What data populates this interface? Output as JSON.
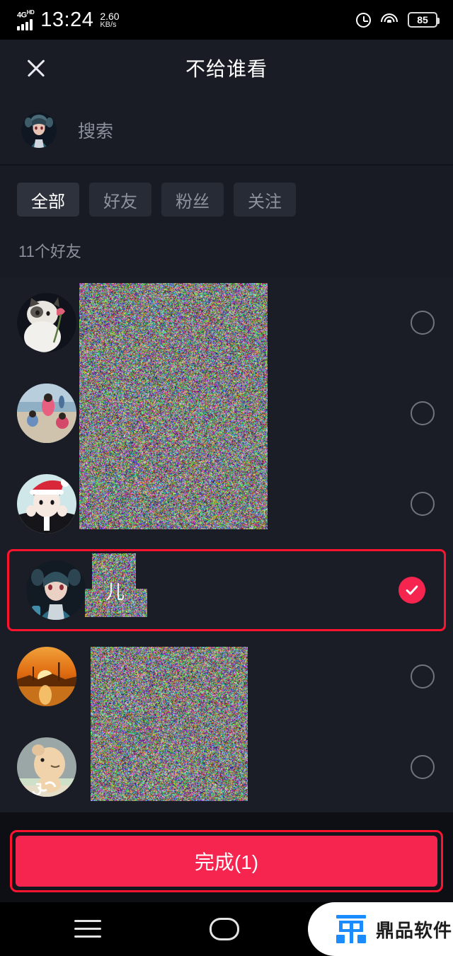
{
  "status_bar": {
    "network_type": "4G",
    "network_suffix": "HD",
    "time": "13:24",
    "data_rate_value": "2.60",
    "data_rate_unit": "KB/s",
    "alarm_icon": "alarm-clock-icon",
    "wifi_icon": "wifi-icon",
    "battery_level": "85"
  },
  "header": {
    "close_icon": "close-icon",
    "title": "不给谁看"
  },
  "search": {
    "avatar_name": "user-avatar",
    "placeholder": "搜索"
  },
  "filters": {
    "chips": [
      {
        "label": "全部",
        "active": true
      },
      {
        "label": "好友",
        "active": false
      },
      {
        "label": "粉丝",
        "active": false
      },
      {
        "label": "关注",
        "active": false
      }
    ],
    "count_label": "11个好友"
  },
  "list": {
    "rows": [
      {
        "name": "",
        "avatar": "cat-with-rose-avatar",
        "selected": false,
        "censored": true
      },
      {
        "name": "",
        "avatar": "children-on-beach-avatar",
        "selected": false,
        "censored": true
      },
      {
        "name": "",
        "avatar": "santa-hat-girl-avatar",
        "selected": false,
        "censored": true
      },
      {
        "name": "儿",
        "avatar": "anime-girl-avatar",
        "selected": true,
        "censored": true
      },
      {
        "name": "",
        "avatar": "sunset-avatar",
        "selected": false,
        "censored": true
      },
      {
        "name": "",
        "avatar": "cartoon-bear-avatar",
        "selected": false,
        "censored": true
      }
    ]
  },
  "done_button": {
    "label": "完成(1)"
  },
  "nav_bar": {
    "menu_icon": "menu-icon",
    "home_icon": "home-icon",
    "watermark_logo": "dingpin-logo-icon",
    "watermark_text": "鼎品软件"
  },
  "colors": {
    "accent": "#f5254f",
    "annotation": "#ff1430",
    "background": "#1a1d26",
    "header_bg": "#191c24",
    "logo_blue": "#1a8cff"
  }
}
